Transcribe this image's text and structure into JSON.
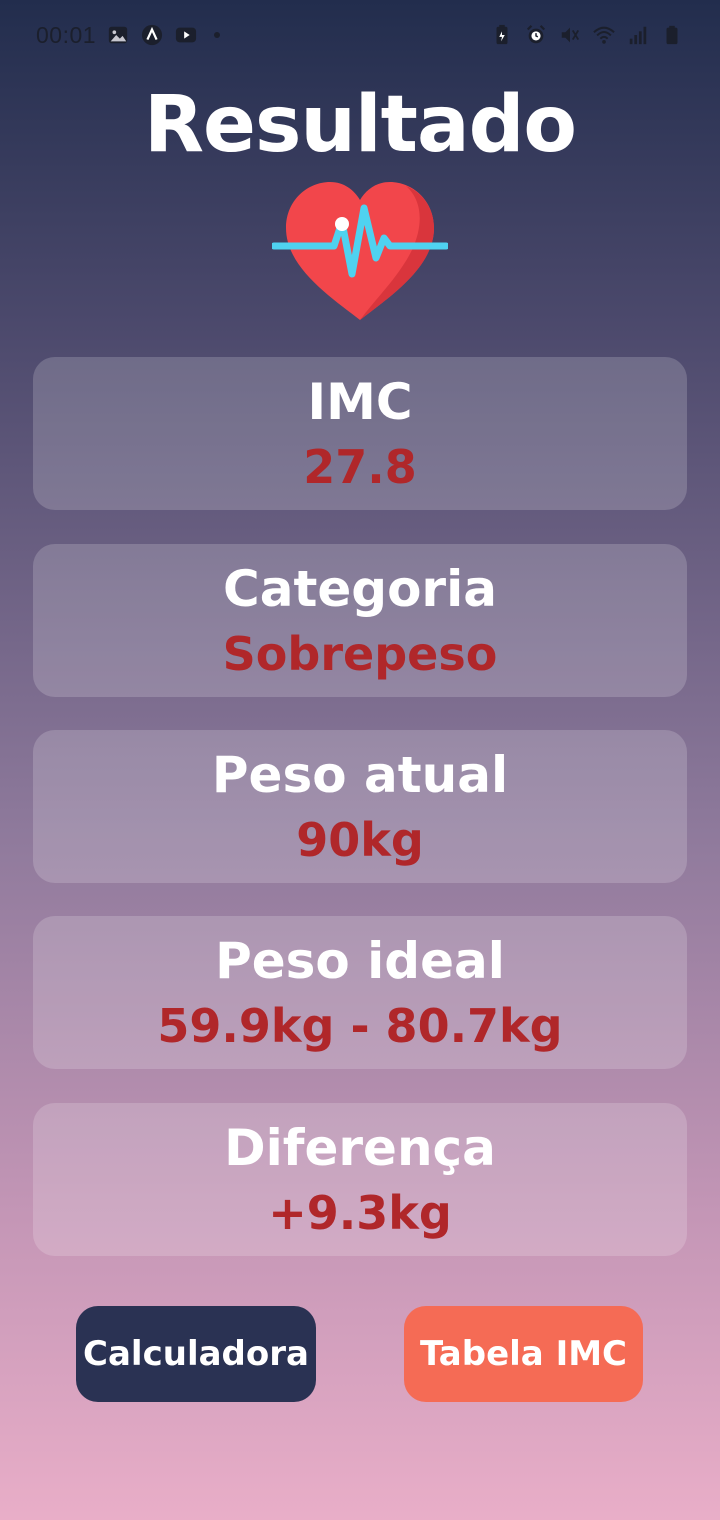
{
  "status_bar": {
    "time": "00:01",
    "left_icons": [
      "gallery-icon",
      "app-icon",
      "youtube-icon"
    ],
    "right_icons": [
      "battery-saver-icon",
      "alarm-icon",
      "mute-icon",
      "wifi-icon",
      "signal-icon",
      "battery-icon"
    ]
  },
  "page": {
    "title": "Resultado"
  },
  "cards": [
    {
      "label": "IMC",
      "value": "27.8"
    },
    {
      "label": "Categoria",
      "value": "Sobrepeso"
    },
    {
      "label": "Peso atual",
      "value": "90kg"
    },
    {
      "label": "Peso ideal",
      "value": "59.9kg - 80.7kg"
    },
    {
      "label": "Diferença",
      "value": "+9.3kg"
    }
  ],
  "buttons": {
    "calculator": "Calculadora",
    "bmi_table": "Tabela IMC"
  },
  "colors": {
    "value_red": "#b0272a",
    "calculator_bg": "#2a3253",
    "bmi_table_bg": "#f56b55"
  }
}
